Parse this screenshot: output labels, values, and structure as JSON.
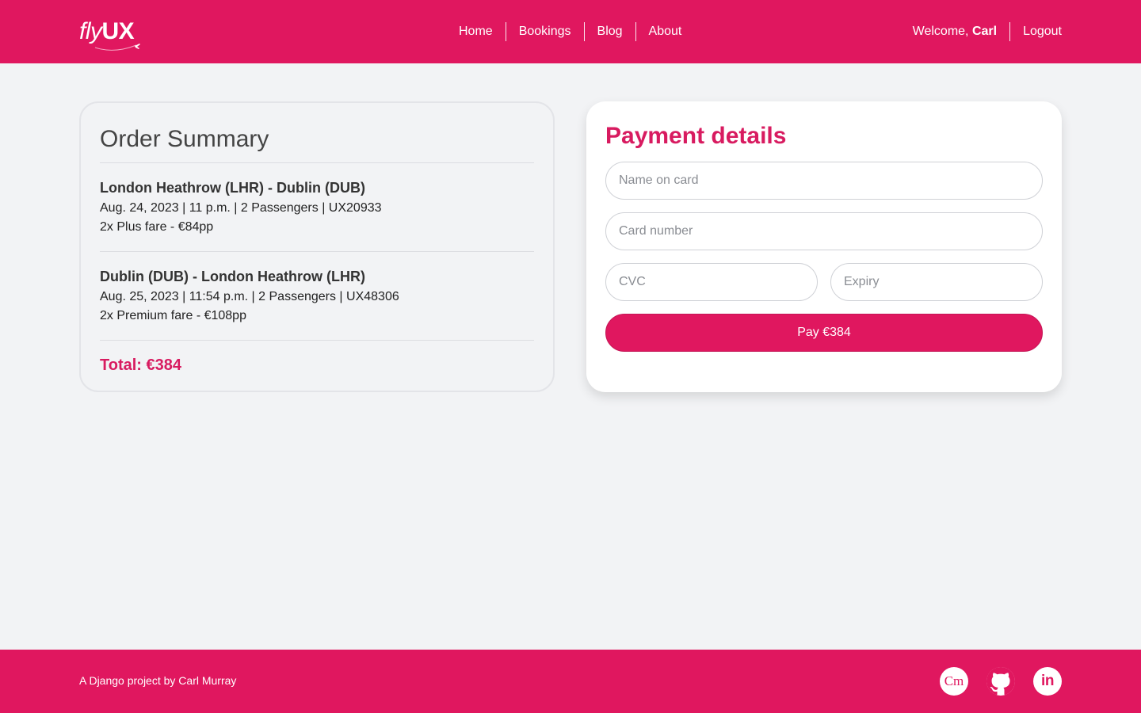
{
  "brand": {
    "logo_fly": "fly",
    "logo_ux": "UX",
    "color": "#e0175f"
  },
  "nav": {
    "items": [
      {
        "label": "Home"
      },
      {
        "label": "Bookings"
      },
      {
        "label": "Blog"
      },
      {
        "label": "About"
      }
    ],
    "welcome_prefix": "Welcome, ",
    "username": "Carl",
    "logout_label": "Logout"
  },
  "order_summary": {
    "title": "Order Summary",
    "flights": [
      {
        "route": "London Heathrow (LHR) - Dublin (DUB)",
        "meta": "Aug. 24, 2023 | 11 p.m. | 2 Passengers | UX20933",
        "fare": "2x Plus fare - €84pp"
      },
      {
        "route": "Dublin (DUB) - London Heathrow (LHR)",
        "meta": "Aug. 25, 2023 | 11:54 p.m. | 2 Passengers | UX48306",
        "fare": "2x Premium fare - €108pp"
      }
    ],
    "total": "Total: €384"
  },
  "payment": {
    "title": "Payment details",
    "name_placeholder": "Name on card",
    "card_number_placeholder": "Card number",
    "cvc_placeholder": "CVC",
    "expiry_placeholder": "Expiry",
    "pay_label": "Pay €384"
  },
  "footer": {
    "prefix": "A Django project by ",
    "author": "Carl Murray",
    "socials": [
      {
        "icon": "cm-portfolio-icon",
        "text": "Cm"
      },
      {
        "icon": "github-icon"
      },
      {
        "icon": "linkedin-icon",
        "text": "in"
      }
    ]
  }
}
